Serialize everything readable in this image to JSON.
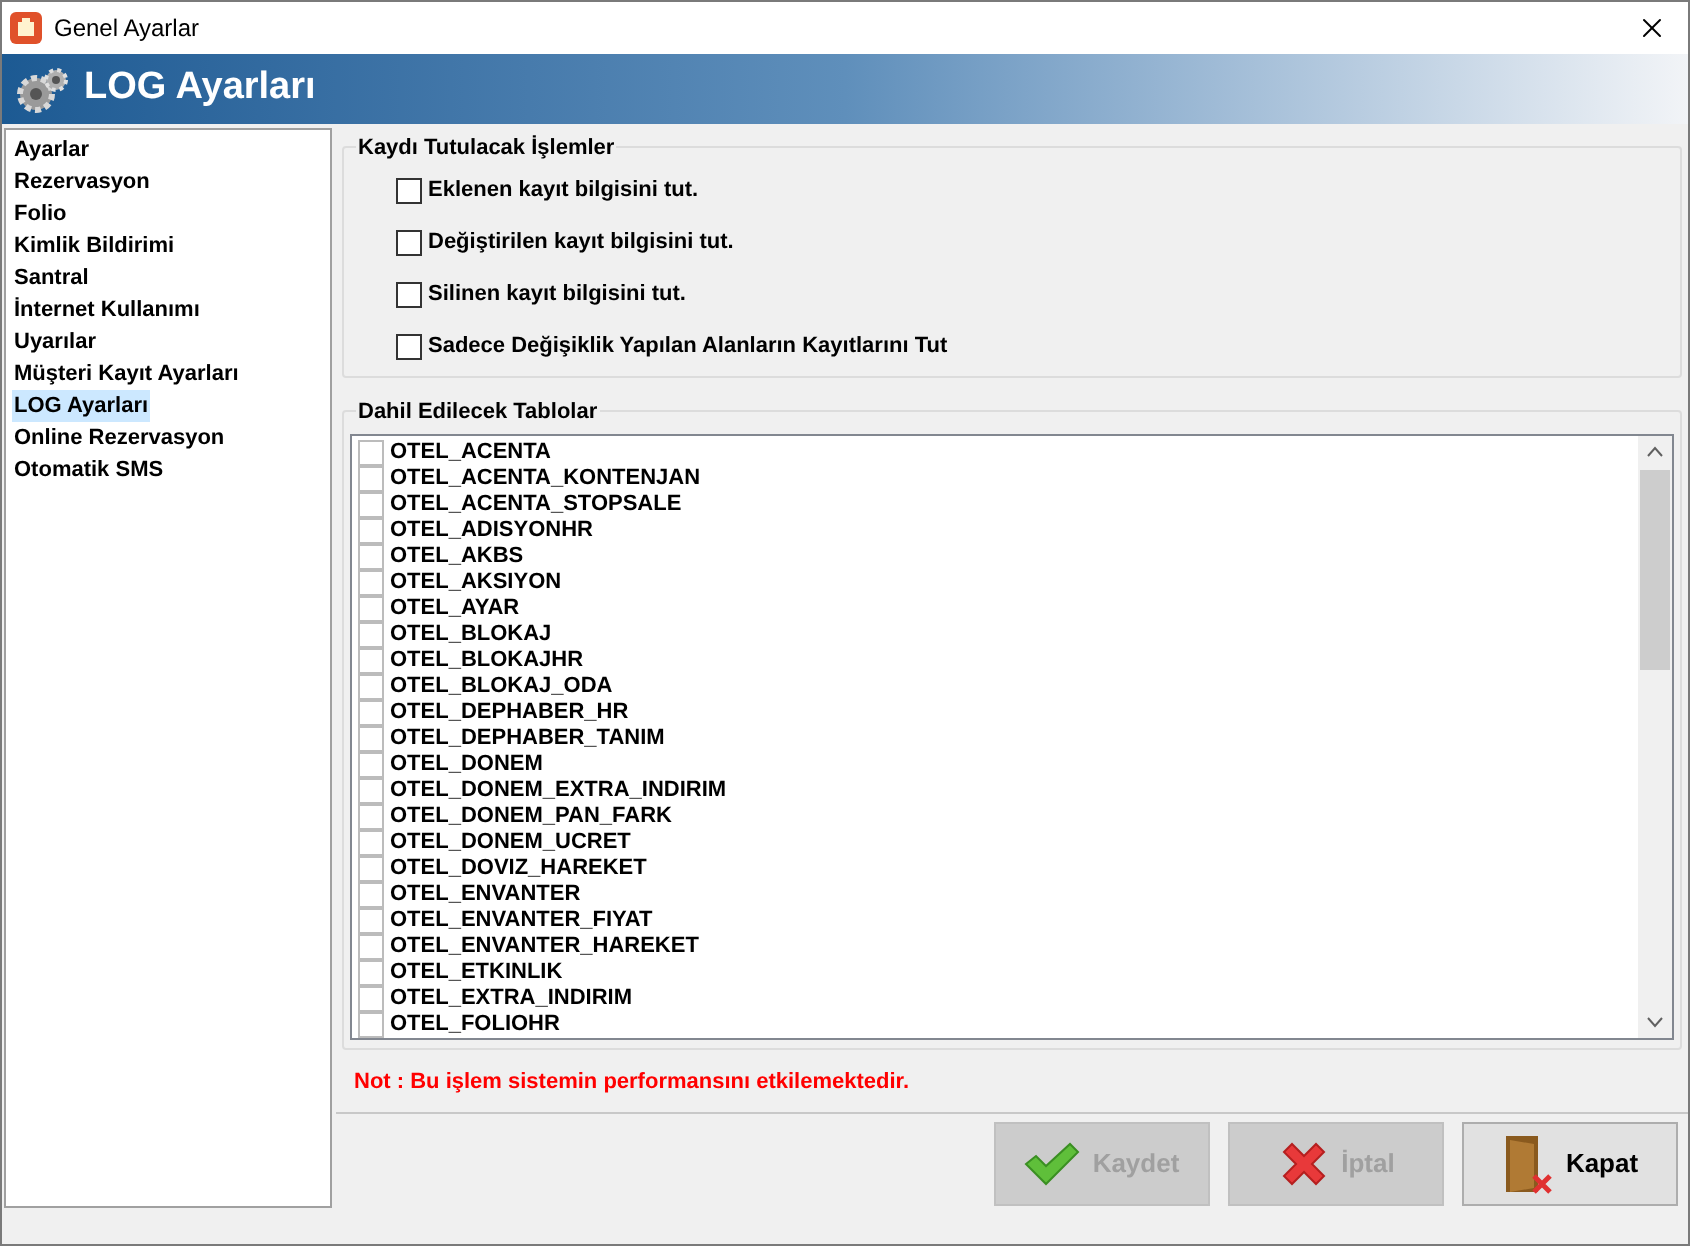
{
  "window": {
    "title": "Genel Ayarlar"
  },
  "header": {
    "title": "LOG Ayarları"
  },
  "sidebar": {
    "items": [
      {
        "label": "Ayarlar",
        "selected": false
      },
      {
        "label": "Rezervasyon",
        "selected": false
      },
      {
        "label": "Folio",
        "selected": false
      },
      {
        "label": "Kimlik Bildirimi",
        "selected": false
      },
      {
        "label": "Santral",
        "selected": false
      },
      {
        "label": "İnternet Kullanımı",
        "selected": false
      },
      {
        "label": "Uyarılar",
        "selected": false
      },
      {
        "label": "Müşteri Kayıt Ayarları",
        "selected": false
      },
      {
        "label": "LOG Ayarları",
        "selected": true
      },
      {
        "label": "Online Rezervasyon",
        "selected": false
      },
      {
        "label": "Otomatik SMS",
        "selected": false
      }
    ]
  },
  "operations": {
    "title": "Kaydı Tutulacak İşlemler",
    "options": [
      {
        "label": "Eklenen kayıt bilgisini tut.",
        "checked": false
      },
      {
        "label": "Değiştirilen kayıt bilgisini tut.",
        "checked": false
      },
      {
        "label": "Silinen kayıt bilgisini tut.",
        "checked": false
      },
      {
        "label": "Sadece Değişiklik Yapılan Alanların Kayıtlarını Tut",
        "checked": false
      }
    ]
  },
  "tables": {
    "title": "Dahil Edilecek Tablolar",
    "items": [
      {
        "label": "OTEL_ACENTA",
        "checked": false
      },
      {
        "label": "OTEL_ACENTA_KONTENJAN",
        "checked": false
      },
      {
        "label": "OTEL_ACENTA_STOPSALE",
        "checked": false
      },
      {
        "label": "OTEL_ADISYONHR",
        "checked": false
      },
      {
        "label": "OTEL_AKBS",
        "checked": false
      },
      {
        "label": "OTEL_AKSIYON",
        "checked": false
      },
      {
        "label": "OTEL_AYAR",
        "checked": false
      },
      {
        "label": "OTEL_BLOKAJ",
        "checked": false
      },
      {
        "label": "OTEL_BLOKAJHR",
        "checked": false
      },
      {
        "label": "OTEL_BLOKAJ_ODA",
        "checked": false
      },
      {
        "label": "OTEL_DEPHABER_HR",
        "checked": false
      },
      {
        "label": "OTEL_DEPHABER_TANIM",
        "checked": false
      },
      {
        "label": "OTEL_DONEM",
        "checked": false
      },
      {
        "label": "OTEL_DONEM_EXTRA_INDIRIM",
        "checked": false
      },
      {
        "label": "OTEL_DONEM_PAN_FARK",
        "checked": false
      },
      {
        "label": "OTEL_DONEM_UCRET",
        "checked": false
      },
      {
        "label": "OTEL_DOVIZ_HAREKET",
        "checked": false
      },
      {
        "label": "OTEL_ENVANTER",
        "checked": false
      },
      {
        "label": "OTEL_ENVANTER_FIYAT",
        "checked": false
      },
      {
        "label": "OTEL_ENVANTER_HAREKET",
        "checked": false
      },
      {
        "label": "OTEL_ETKINLIK",
        "checked": false
      },
      {
        "label": "OTEL_EXTRA_INDIRIM",
        "checked": false
      },
      {
        "label": "OTEL_FOLIOHR",
        "checked": false
      }
    ]
  },
  "note": "Not : Bu işlem sistemin performansını etkilemektedir.",
  "buttons": [
    {
      "label": "Kaydet",
      "kind": "save",
      "disabled": true
    },
    {
      "label": "İptal",
      "kind": "cancel",
      "disabled": true
    },
    {
      "label": "Kapat",
      "kind": "close",
      "disabled": false
    }
  ]
}
